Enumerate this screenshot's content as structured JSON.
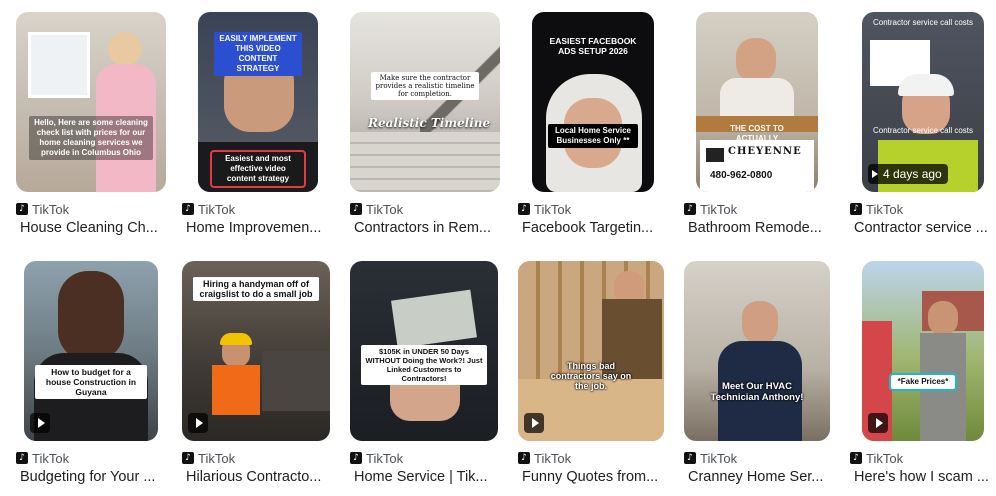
{
  "results": [
    {
      "source": "TikTok",
      "title": "House Cleaning Ch...",
      "caption": "Hello, Here are some cleaning check list with prices for our home cleaning services we provide in Columbus Ohio"
    },
    {
      "source": "TikTok",
      "title": "Home Improvemen...",
      "caption": "EASILY IMPLEMENT THIS VIDEO CONTENT STRATEGY",
      "caption2": "Easiest and most effective video content strategy"
    },
    {
      "source": "TikTok",
      "title": "Contractors in Rem...",
      "caption": "Make sure the contractor provides a realistic timeline for completion.",
      "caption2": "Realistic Timeline"
    },
    {
      "source": "TikTok",
      "title": "Facebook Targetin...",
      "caption": "EASIEST FACEBOOK ADS SETUP 2026",
      "caption2": "Local Home Service Businesses Only **"
    },
    {
      "source": "TikTok",
      "title": "Bathroom Remode...",
      "caption": "THE COST TO ACTUALLY",
      "caption2": "CHEYENNE",
      "caption3": "480-962-0800"
    },
    {
      "source": "TikTok",
      "title": "Contractor service ...",
      "caption": "Contractor service call costs",
      "caption2": "Contractor service call costs",
      "duration": "4 days ago"
    },
    {
      "source": "TikTok",
      "title": "Budgeting for Your ...",
      "caption": "How to budget for a house Construction in Guyana"
    },
    {
      "source": "TikTok",
      "title": "Hilarious Contracto...",
      "caption": "Hiring a handyman off of craigslist to do a small job"
    },
    {
      "source": "TikTok",
      "title": "Home Service | Tik...",
      "caption": "$105K in UNDER 50 Days WITHOUT Doing the Work?! Just Linked Customers to Contractors!"
    },
    {
      "source": "TikTok",
      "title": "Funny Quotes from...",
      "caption": "Things bad contractors say on the job."
    },
    {
      "source": "TikTok",
      "title": "Cranney Home Ser...",
      "caption": "Meet Our HVAC Technician Anthony!"
    },
    {
      "source": "TikTok",
      "title": "Here's how I scam ...",
      "caption": "*Fake Prices*"
    }
  ]
}
